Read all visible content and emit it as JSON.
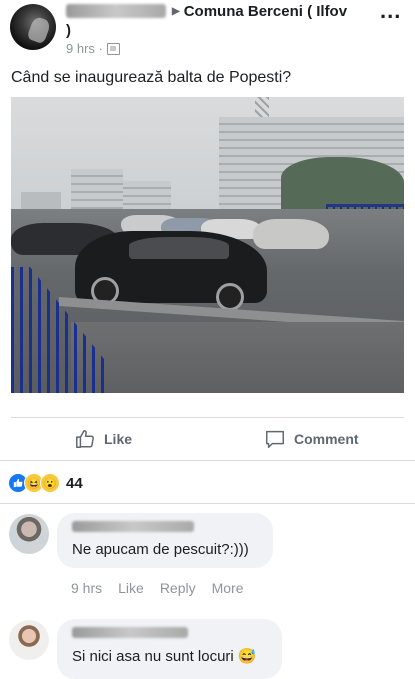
{
  "post": {
    "group_name": "Comuna Berceni ( Ilfov",
    "group_name_cont": ")",
    "time": "9 hrs ·",
    "more_label": "...",
    "text": "Când se inaugurează balta de Popesti?"
  },
  "actions": {
    "like_label": "Like",
    "comment_label": "Comment"
  },
  "reactions": {
    "types": [
      "like",
      "haha",
      "wow"
    ],
    "count": "44",
    "colors": {
      "like": "#1877f2",
      "haha": "#f7c940",
      "wow": "#f7c940"
    }
  },
  "comments": [
    {
      "text": "Ne apucam de pescuit?:)))",
      "time": "9 hrs",
      "like": "Like",
      "reply": "Reply",
      "more": "More"
    },
    {
      "text": "Si nici asa nu sunt locuri 😅"
    }
  ]
}
